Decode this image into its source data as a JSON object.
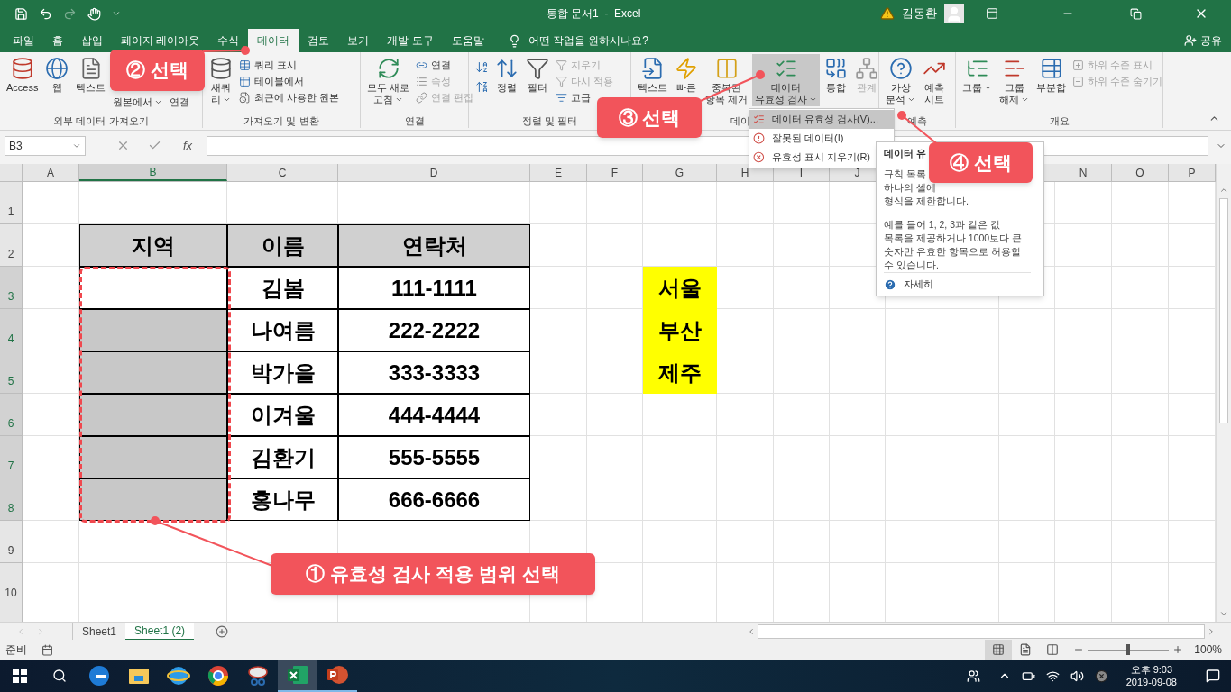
{
  "window": {
    "title": "통합 문서1  -  Excel",
    "user": "김동환"
  },
  "tabs": [
    {
      "label": "파일",
      "selected": false
    },
    {
      "label": "홈",
      "selected": false
    },
    {
      "label": "삽입",
      "selected": false
    },
    {
      "label": "페이지 레이아웃",
      "selected": false
    },
    {
      "label": "수식",
      "selected": false
    },
    {
      "label": "데이터",
      "selected": true
    },
    {
      "label": "검토",
      "selected": false
    },
    {
      "label": "보기",
      "selected": false
    },
    {
      "label": "개발 도구",
      "selected": false
    },
    {
      "label": "도움말",
      "selected": false
    }
  ],
  "tell_me": {
    "placeholder": "어떤 작업을 원하시나요?"
  },
  "share": "공유",
  "ribbon": {
    "groups": [
      {
        "label": "외부 데이터 가져오기",
        "buttons": [
          {
            "kind": "large",
            "lines": [
              "Access"
            ],
            "dropdown": false,
            "disabled": false,
            "pressed": false
          },
          {
            "kind": "large",
            "lines": [
              "웹"
            ],
            "dropdown": false,
            "disabled": false,
            "pressed": false
          },
          {
            "kind": "large",
            "lines": [
              "텍스트"
            ],
            "dropdown": false,
            "disabled": false,
            "pressed": false
          },
          {
            "kind": "large",
            "lines": [
              "원본에서"
            ],
            "dropdown": true,
            "disabled": false,
            "pressed": false
          },
          {
            "kind": "large",
            "lines": [
              "연결"
            ],
            "dropdown": false,
            "disabled": false,
            "pressed": false
          }
        ]
      },
      {
        "label": "가져오기 및 변환",
        "buttons": [
          {
            "kind": "large",
            "lines": [
              "새쿼",
              "리"
            ],
            "dropdown": true,
            "disabled": false,
            "pressed": false
          },
          {
            "kind": "small",
            "lines": [
              "쿼리 표시"
            ],
            "disabled": false,
            "pressed": false
          },
          {
            "kind": "small",
            "lines": [
              "테이블에서"
            ],
            "disabled": false,
            "pressed": false
          },
          {
            "kind": "small",
            "lines": [
              "최근에 사용한 원본"
            ],
            "disabled": false,
            "pressed": false
          }
        ]
      },
      {
        "label": "연결",
        "buttons": [
          {
            "kind": "large",
            "lines": [
              "모두 새로",
              "고침"
            ],
            "dropdown": true,
            "disabled": false,
            "pressed": false
          },
          {
            "kind": "small",
            "lines": [
              "연결"
            ],
            "disabled": false,
            "pressed": false
          },
          {
            "kind": "small",
            "lines": [
              "속성"
            ],
            "disabled": true,
            "pressed": false
          },
          {
            "kind": "small",
            "lines": [
              "연결 편집"
            ],
            "disabled": true,
            "pressed": false
          }
        ]
      },
      {
        "label": "정렬 및 필터",
        "buttons": [
          {
            "kind": "icon",
            "disabled": false,
            "pressed": false
          },
          {
            "kind": "icon",
            "disabled": false,
            "pressed": false
          },
          {
            "kind": "large",
            "lines": [
              "정렬"
            ],
            "dropdown": false,
            "disabled": false,
            "pressed": false
          },
          {
            "kind": "large",
            "lines": [
              "필터"
            ],
            "dropdown": false,
            "disabled": false,
            "pressed": false
          },
          {
            "kind": "small",
            "lines": [
              "지우기"
            ],
            "disabled": true,
            "pressed": false
          },
          {
            "kind": "small",
            "lines": [
              "다시 적용"
            ],
            "disabled": true,
            "pressed": false
          },
          {
            "kind": "small",
            "lines": [
              "고급"
            ],
            "disabled": false,
            "pressed": false
          }
        ]
      },
      {
        "label": "데이",
        "buttons": [
          {
            "kind": "large",
            "lines": [
              "텍스트"
            ],
            "dropdown": false,
            "disabled": false,
            "pressed": false
          },
          {
            "kind": "large",
            "lines": [
              "빠른"
            ],
            "dropdown": false,
            "disabled": false,
            "pressed": false
          },
          {
            "kind": "large",
            "lines": [
              "중복된",
              "항목 제거"
            ],
            "dropdown": false,
            "disabled": false,
            "pressed": false
          },
          {
            "kind": "large",
            "lines": [
              "데이터",
              "유효성 검사"
            ],
            "dropdown": true,
            "disabled": false,
            "pressed": true
          },
          {
            "kind": "large",
            "lines": [
              "통합"
            ],
            "dropdown": false,
            "disabled": false,
            "pressed": false
          },
          {
            "kind": "large",
            "lines": [
              "관계"
            ],
            "dropdown": false,
            "disabled": true,
            "pressed": false
          }
        ]
      },
      {
        "label": "예측",
        "buttons": [
          {
            "kind": "large",
            "lines": [
              "가상",
              "분석"
            ],
            "dropdown": true,
            "disabled": false,
            "pressed": false
          },
          {
            "kind": "large",
            "lines": [
              "예측",
              "시트"
            ],
            "dropdown": false,
            "disabled": false,
            "pressed": false
          }
        ]
      },
      {
        "label": "개요",
        "buttons": [
          {
            "kind": "large",
            "lines": [
              "그룹"
            ],
            "dropdown": true,
            "disabled": false,
            "pressed": false
          },
          {
            "kind": "large",
            "lines": [
              "그룹",
              "해제"
            ],
            "dropdown": true,
            "disabled": false,
            "pressed": false
          },
          {
            "kind": "large",
            "lines": [
              "부분합"
            ],
            "dropdown": false,
            "disabled": false,
            "pressed": false
          },
          {
            "kind": "small",
            "lines": [
              "하위 수준 표시"
            ],
            "disabled": true,
            "pressed": false
          },
          {
            "kind": "small",
            "lines": [
              "하위 수준 숨기기"
            ],
            "disabled": true,
            "pressed": false
          }
        ]
      }
    ]
  },
  "formula_bar": {
    "name_box": "B3",
    "function_label": "fx"
  },
  "sheet": {
    "columns": [
      "A",
      "B",
      "C",
      "D",
      "E",
      "F",
      "G",
      "H",
      "I",
      "J",
      "N",
      "O",
      "P"
    ],
    "rows": [
      "1",
      "2",
      "3",
      "4",
      "5",
      "6",
      "7",
      "8",
      "9",
      "10"
    ],
    "table": {
      "headers": [
        "지역",
        "이름",
        "연락처"
      ],
      "rows": [
        {
          "name": "김봄",
          "contact": "111-1111",
          "active": true
        },
        {
          "name": "나여름",
          "contact": "222-2222",
          "active": false
        },
        {
          "name": "박가을",
          "contact": "333-3333",
          "active": false
        },
        {
          "name": "이겨울",
          "contact": "444-4444",
          "active": false
        },
        {
          "name": "김환기",
          "contact": "555-5555",
          "active": false
        },
        {
          "name": "홍나무",
          "contact": "666-6666",
          "active": false
        }
      ]
    },
    "list_values": [
      "서울",
      "부산",
      "제주"
    ]
  },
  "menu": {
    "items": [
      {
        "label": "데이터 유효성 검사(V)...",
        "selected": true
      },
      {
        "label": "잘못된 데이터(I)",
        "selected": false
      },
      {
        "label": "유효성 표시 지우기(R)",
        "selected": false
      }
    ]
  },
  "tooltip": {
    "title": "데이터 유",
    "lines": [
      "규칙 목록",
      "하나의 셀에",
      "형식을 제한합니다."
    ],
    "paragraph": "예를 들어 1, 2, 3과 같은 값 목록을 제공하거나 1000보다 큰 숫자만 유효한 항목으로 허용할 수 있습니다.",
    "link": "자세히"
  },
  "callouts": [
    {
      "label": "① 유효성 검사 적용 범위 선택"
    },
    {
      "label": "② 선택"
    },
    {
      "label": "③ 선택"
    },
    {
      "label": "④ 선택"
    }
  ],
  "sheet_tabs": [
    {
      "label": "Sheet1",
      "selected": false
    },
    {
      "label": "Sheet1 (2)",
      "selected": true
    }
  ],
  "status_bar": {
    "text": "준비",
    "views": [
      {
        "selected": true
      },
      {
        "selected": false
      },
      {
        "selected": false
      }
    ],
    "zoom": {
      "level": 0.5
    },
    "zoom_text": "100%"
  },
  "taskbar": {
    "apps": [
      {
        "active": false,
        "running": false
      },
      {
        "active": false,
        "running": false
      },
      {
        "active": false,
        "running": false
      },
      {
        "active": false,
        "running": false
      },
      {
        "active": false,
        "running": false
      },
      {
        "active": true,
        "running": true
      },
      {
        "active": false,
        "running": true
      }
    ],
    "time": "오후 9:03",
    "date": "2019-09-08"
  }
}
